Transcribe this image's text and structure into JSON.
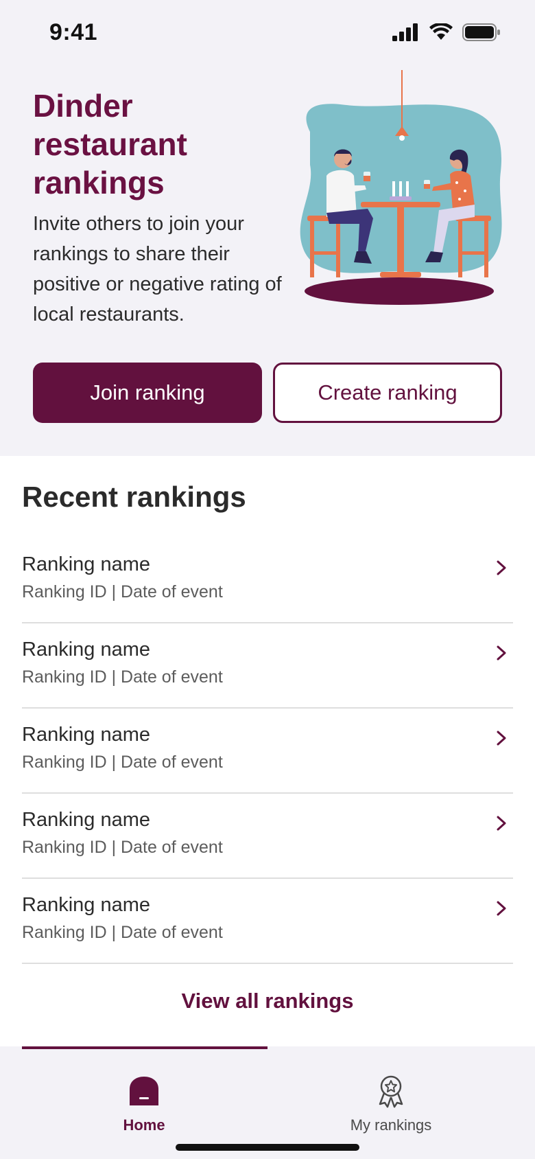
{
  "status_bar": {
    "time": "9:41"
  },
  "hero": {
    "title": "Dinder restaurant rankings",
    "description": "Invite others to join your rankings to share their positive or negative rating of local restaurants.",
    "join_label": "Join ranking",
    "create_label": "Create ranking"
  },
  "recent": {
    "title": "Recent rankings",
    "items": [
      {
        "name": "Ranking name",
        "sub": "Ranking ID | Date of event"
      },
      {
        "name": "Ranking name",
        "sub": "Ranking ID | Date of event"
      },
      {
        "name": "Ranking name",
        "sub": "Ranking ID | Date of event"
      },
      {
        "name": "Ranking name",
        "sub": "Ranking ID | Date of event"
      },
      {
        "name": "Ranking name",
        "sub": "Ranking ID | Date of event"
      }
    ],
    "view_all_label": "View all rankings"
  },
  "tabs": [
    {
      "label": "Home",
      "icon": "home-icon",
      "active": true
    },
    {
      "label": "My rankings",
      "icon": "award-icon",
      "active": false
    }
  ],
  "colors": {
    "brand": "#62113e",
    "illustration_bg": "#7fbfc9",
    "accent": "#e8744a"
  }
}
